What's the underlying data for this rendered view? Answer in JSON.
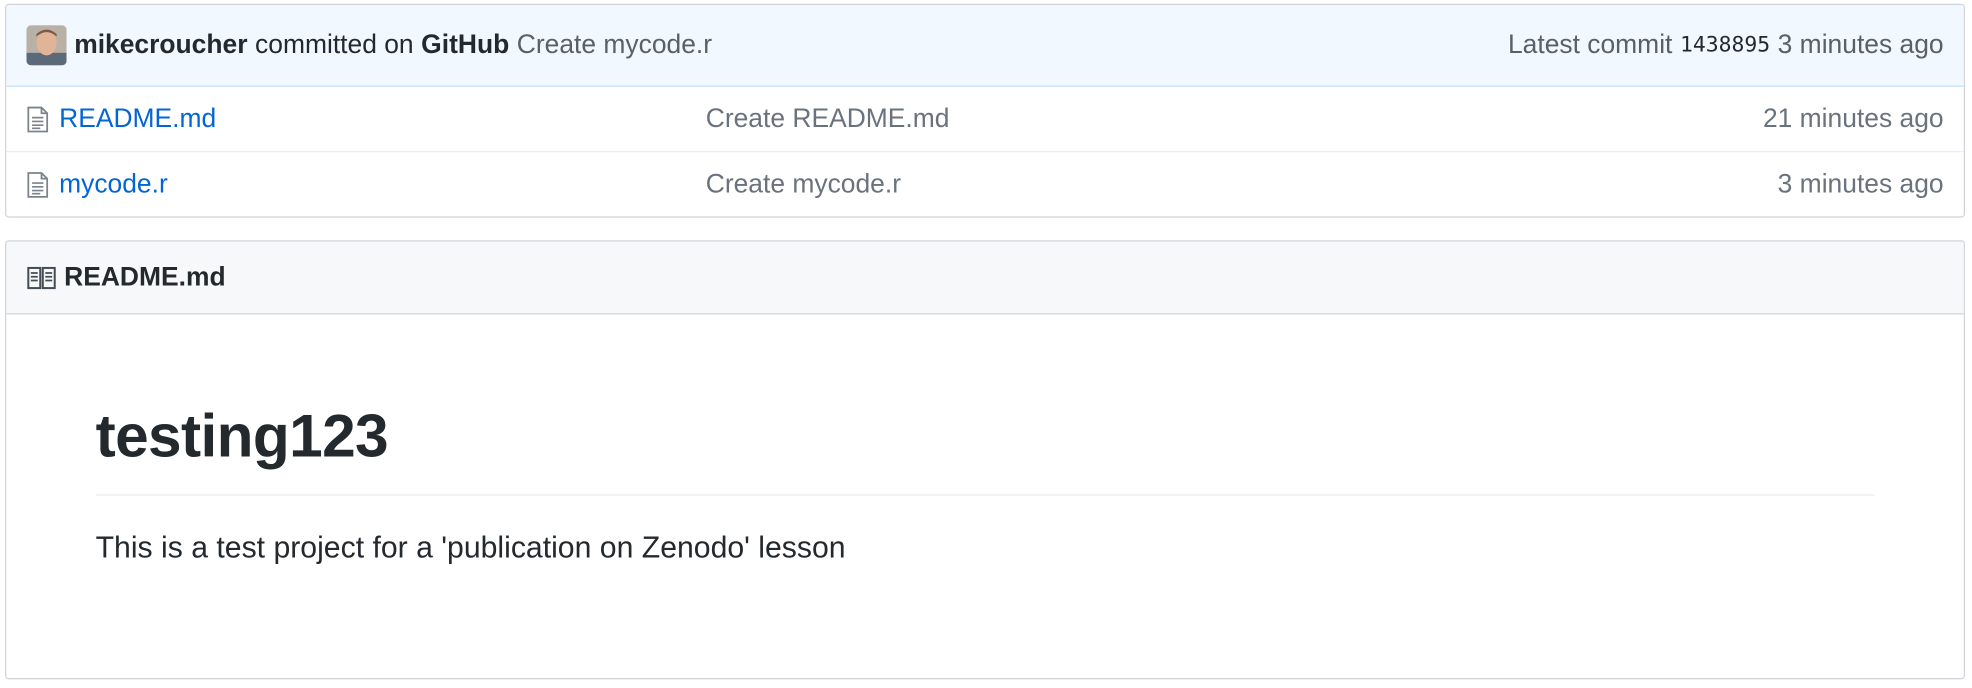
{
  "commit": {
    "author": "mikecroucher",
    "verb": "committed on",
    "committer": "GitHub",
    "message": "Create mycode.r",
    "latest_label": "Latest commit",
    "sha": "1438895",
    "age": "3 minutes ago"
  },
  "files": [
    {
      "name": "README.md",
      "message": "Create README.md",
      "age": "21 minutes ago",
      "icon": "file-text-icon"
    },
    {
      "name": "mycode.r",
      "message": "Create mycode.r",
      "age": "3 minutes ago",
      "icon": "file-text-icon"
    }
  ],
  "readme": {
    "filename": "README.md",
    "icon": "book-icon",
    "heading": "testing123",
    "paragraph": "This is a test project for a 'publication on Zenodo' lesson"
  },
  "colors": {
    "commit_bar_bg": "#f1f8ff",
    "link_blue": "#0366d6",
    "muted_text": "#6a737d",
    "readme_header_bg": "#f6f8fa"
  }
}
